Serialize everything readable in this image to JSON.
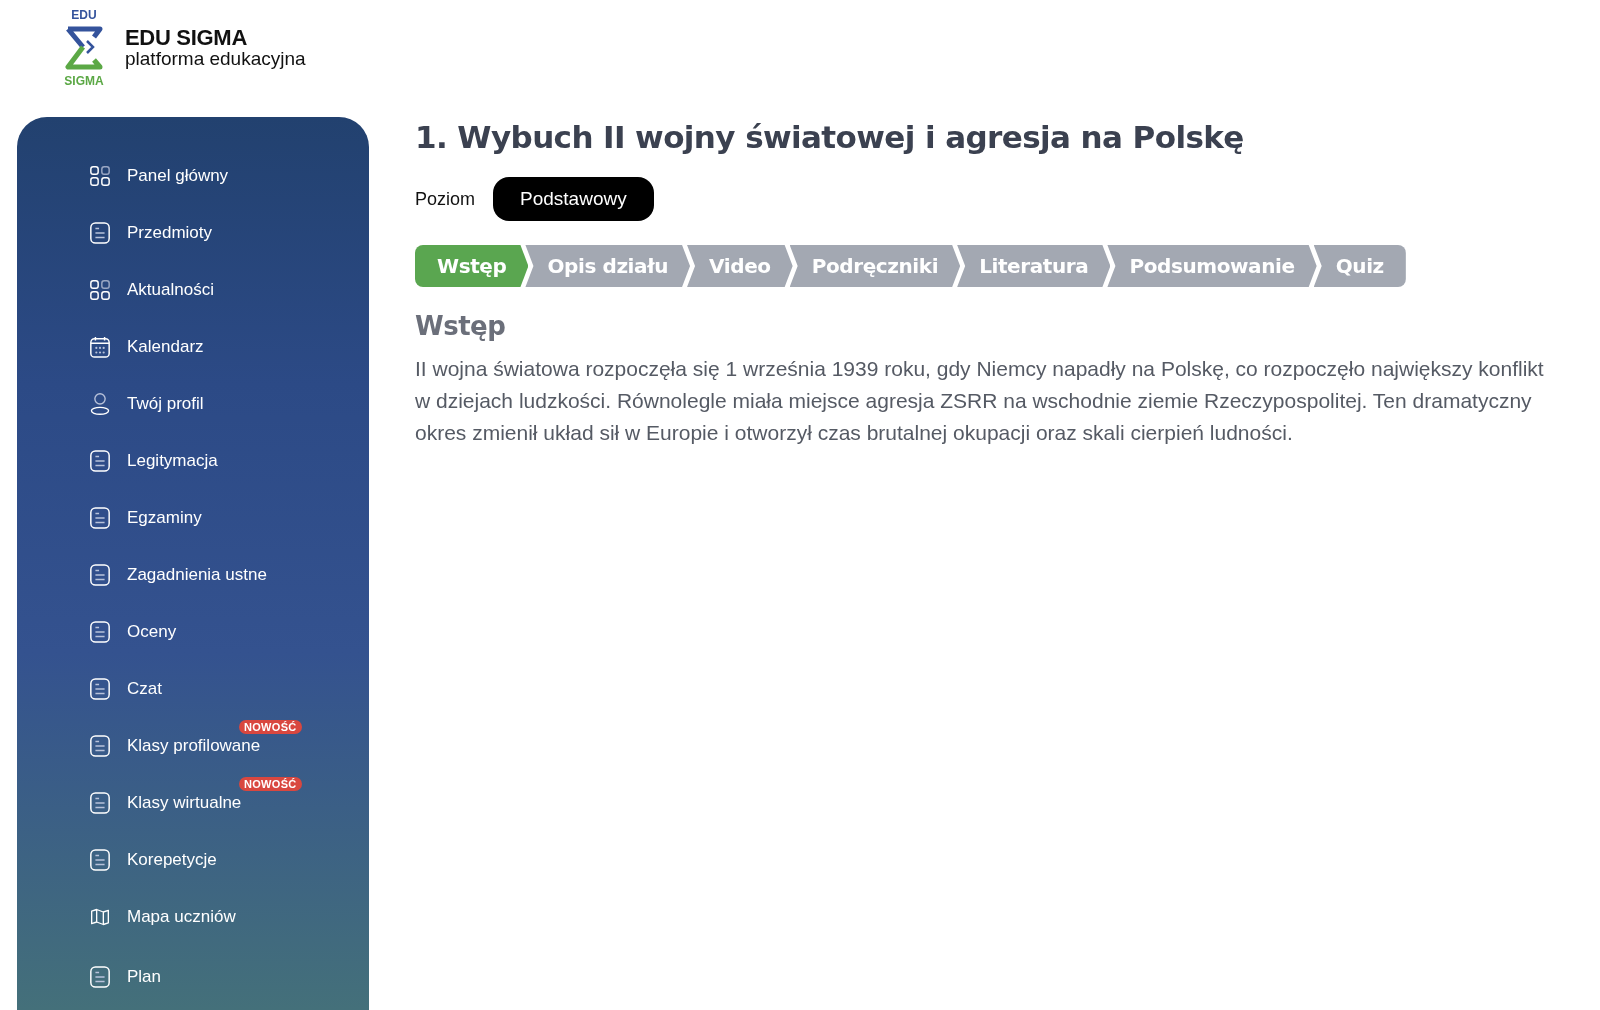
{
  "logo": {
    "mark_top": "EDU",
    "mark_bottom": "SIGMA",
    "title": "EDU SIGMA",
    "subtitle": "platforma edukacyjna"
  },
  "sidebar": {
    "items": [
      {
        "label": "Panel główny"
      },
      {
        "label": "Przedmioty"
      },
      {
        "label": "Aktualności"
      },
      {
        "label": "Kalendarz"
      },
      {
        "label": "Twój profil"
      },
      {
        "label": "Legitymacja"
      },
      {
        "label": "Egzaminy"
      },
      {
        "label": "Zagadnienia ustne"
      },
      {
        "label": "Oceny"
      },
      {
        "label": "Czat"
      },
      {
        "label": "Klasy profilowane",
        "badge": "NOWOŚĆ"
      },
      {
        "label": "Klasy wirtualne",
        "badge": "NOWOŚĆ"
      },
      {
        "label": "Korepetycje"
      },
      {
        "label": "Mapa uczniów"
      },
      {
        "label": "Plan"
      }
    ]
  },
  "page": {
    "title": "1. Wybuch II wojny światowej i agresja na Polskę",
    "level_label": "Poziom",
    "level_value": "Podstawowy",
    "tabs": [
      {
        "label": "Wstęp",
        "selected": true
      },
      {
        "label": "Opis działu",
        "selected": false
      },
      {
        "label": "Video",
        "selected": false
      },
      {
        "label": "Podręczniki",
        "selected": false
      },
      {
        "label": "Literatura",
        "selected": false
      },
      {
        "label": "Podsumowanie",
        "selected": false
      },
      {
        "label": "Quiz",
        "selected": false
      }
    ],
    "section_title": "Wstęp",
    "body": "II wojna światowa rozpoczęła się 1 września 1939 roku, gdy Niemcy napadły na Polskę, co rozpoczęło największy konflikt w dziejach ludzkości. Równolegle miała miejsce agresja ZSRR na wschodnie ziemie Rzeczypospolitej. Ten dramatyczny okres zmienił układ sił w Europie i otworzył czas brutalnej okupacji oraz skali cierpień ludności."
  }
}
